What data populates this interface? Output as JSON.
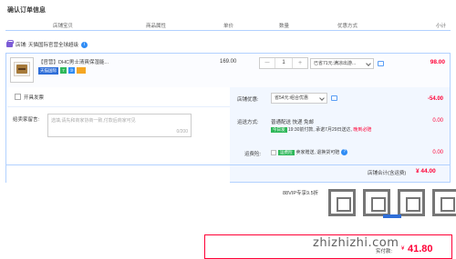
{
  "page": {
    "title": "确认订单信息"
  },
  "table_header": {
    "shop_col": "店铺宝贝",
    "attr_col": "商品属性",
    "price_col": "单价",
    "qty_col": "数量",
    "discount_col": "优惠方式",
    "subtotal_col": "小计"
  },
  "shop": {
    "label": "店铺: 天猫国际官营全球超级",
    "ww_icon": "i"
  },
  "item": {
    "title": "【官营】DHC男士清爽保湿能...",
    "tmall_badge": "天猫国际",
    "badge_a": "7",
    "badge_b": "③",
    "price": "169.00",
    "qty": "1",
    "qty_minus": "－",
    "qty_plus": "+",
    "discount": "已省71元:满凉出游...",
    "subtotal": "98.00"
  },
  "options": {
    "invoice_label": "开具发票",
    "message_label": "给卖家留言:",
    "message_placeholder": "选填,请先和商家协商一致,付款后商家可见",
    "message_count": "0/200",
    "coupon_label": "店铺优惠:",
    "coupon_value": "省54元:组合优惠",
    "coupon_amount": "-54.00",
    "shipping_label": "运送方式:",
    "shipping_value": "普通配送 快递 免邮",
    "shipping_badge": "今日发",
    "shipping_note_pre": "19:30前付款, 承诺7月29日送达, ",
    "shipping_note_link": "晚到必赔",
    "shipping_amount": "0.00",
    "insurance_label": "运费险:",
    "insurance_badge": "运费险",
    "insurance_text": "卖家赠送, 退换货可赔",
    "insurance_amount": "0.00"
  },
  "shop_total": {
    "label": "店铺合计(含运费)",
    "value": "¥ 44.00"
  },
  "vip": {
    "text": "88VIP专享9.5折"
  },
  "final": {
    "label": "实付款:",
    "currency": "¥",
    "value": "41.80"
  },
  "watermark": {
    "text": "zhizhizhi.com"
  },
  "colors": {
    "accent_red": "#ff0036",
    "border_blue": "#b2d1ff",
    "panel_blue": "#f2f7ff",
    "tmall_blue": "#2f6ed8",
    "badge_green": "#2fb85a"
  }
}
